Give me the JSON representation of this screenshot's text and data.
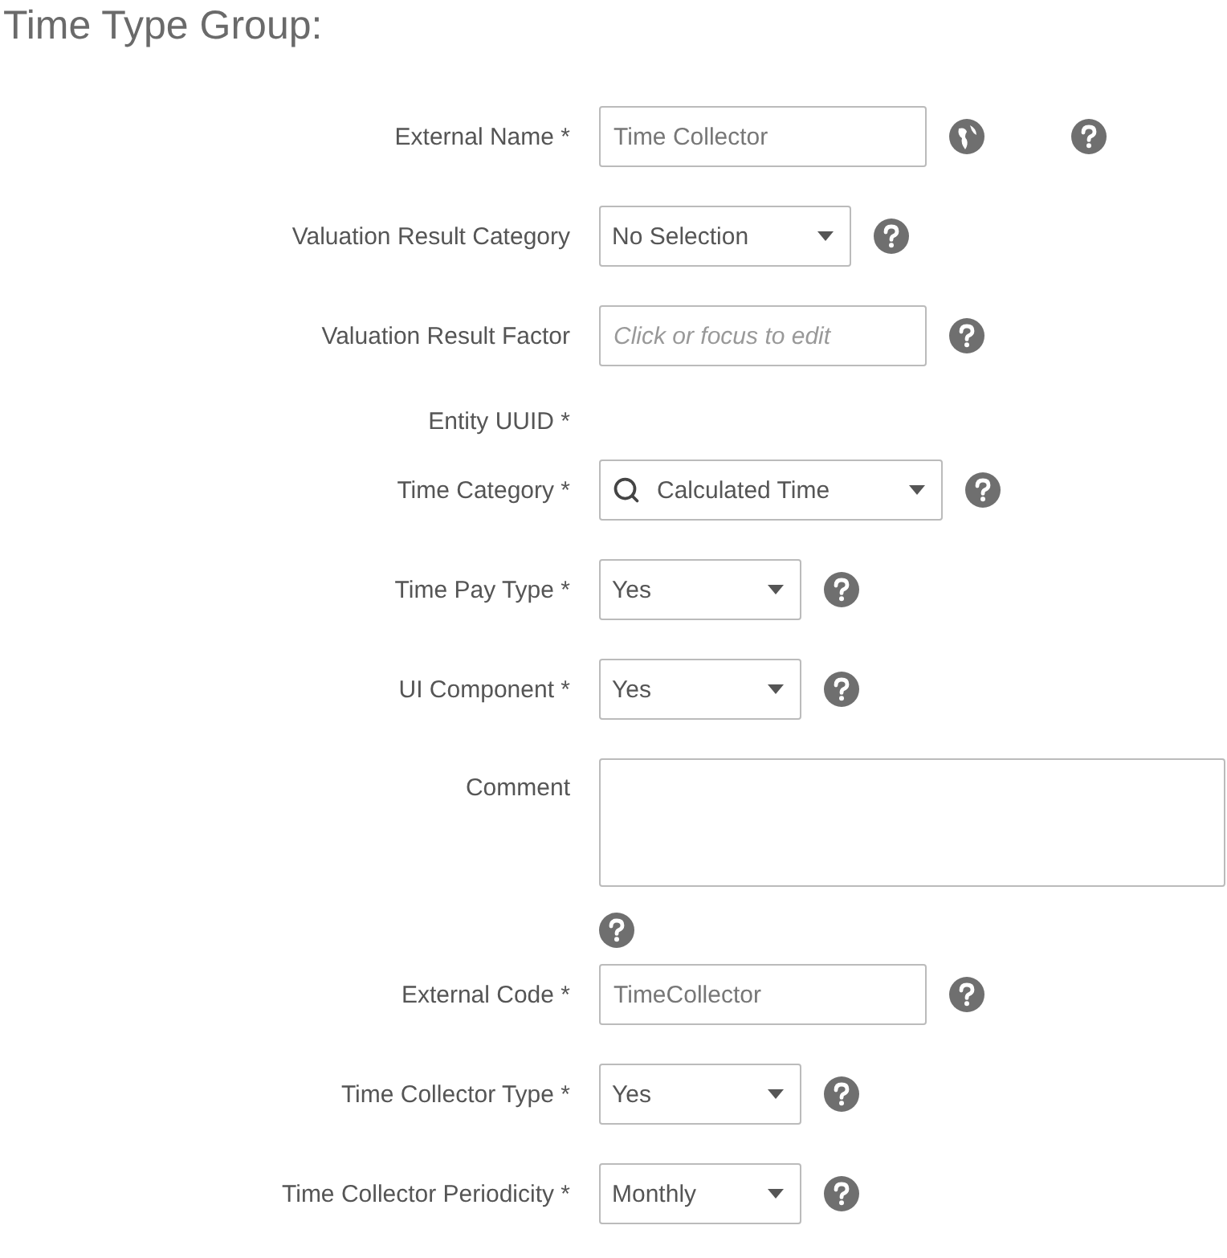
{
  "title": "Time Type Group:",
  "fields": [
    {
      "label": "External Name *",
      "kind": "text",
      "value": "Time Collector",
      "translatable": true,
      "help": true
    },
    {
      "label": "Valuation Result Category",
      "kind": "select",
      "value": "No Selection",
      "help": true
    },
    {
      "label": "Valuation Result Factor",
      "kind": "text",
      "placeholder": "Click or focus to edit",
      "help": true
    },
    {
      "label": "Entity UUID *",
      "kind": "none"
    },
    {
      "label": "Time Category *",
      "kind": "search-select",
      "value": "Calculated Time",
      "help": true
    },
    {
      "label": "Time Pay Type *",
      "kind": "select",
      "value": "Yes",
      "help": true
    },
    {
      "label": "UI Component *",
      "kind": "select",
      "value": "Yes",
      "help": true
    },
    {
      "label": "Comment",
      "kind": "textarea",
      "help": true
    },
    {
      "label": "External Code *",
      "kind": "text",
      "value": "TimeCollector",
      "help": true
    },
    {
      "label": "Time Collector Type *",
      "kind": "select",
      "value": "Yes",
      "help": true
    },
    {
      "label": "Time Collector Periodicity *",
      "kind": "select",
      "value": "Monthly",
      "help": true
    }
  ]
}
